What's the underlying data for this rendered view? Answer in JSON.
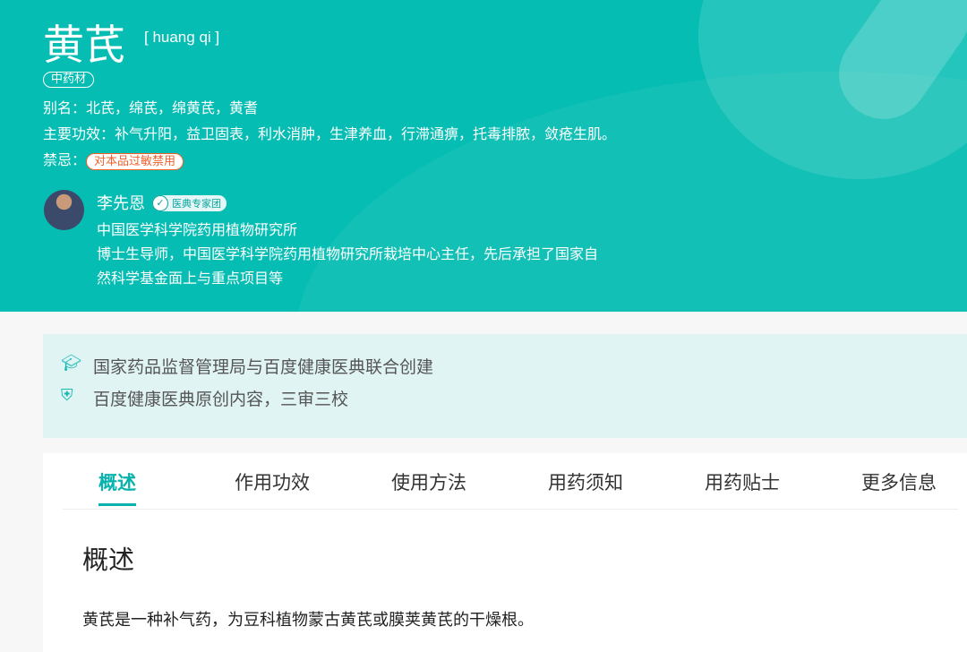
{
  "header": {
    "title": "黄芪",
    "pinyin": "[ huang qi ]",
    "category_tag": "中药材",
    "alias_label": "别名：",
    "alias": "北芪，绵芪，绵黄芪，黄耆",
    "effect_label": "主要功效：",
    "effect": "补气升阳，益卫固表，利水消肿，生津养血，行滞通痹，托毒排脓，敛疮生肌。",
    "contra_label": "禁忌：",
    "contra": "对本品过敏禁用"
  },
  "expert": {
    "name": "李先恩",
    "badge": "医典专家团",
    "org": "中国医学科学院药用植物研究所",
    "bio_line1": "博士生导师，中国医学科学院药用植物研究所栽培中心主任，先后承担了国家自",
    "bio_line2": "然科学基金面上与重点项目等"
  },
  "notice": {
    "line1": "国家药品监督管理局与百度健康医典联合创建",
    "line2": "百度健康医典原创内容，三审三校"
  },
  "tabs": [
    "概述",
    "作用功效",
    "使用方法",
    "用药须知",
    "用药贴士",
    "更多信息"
  ],
  "section": {
    "heading": "概述",
    "text": "黄芪是一种补气药，为豆科植物蒙古黄芪或膜荚黄芪的干燥根。"
  }
}
